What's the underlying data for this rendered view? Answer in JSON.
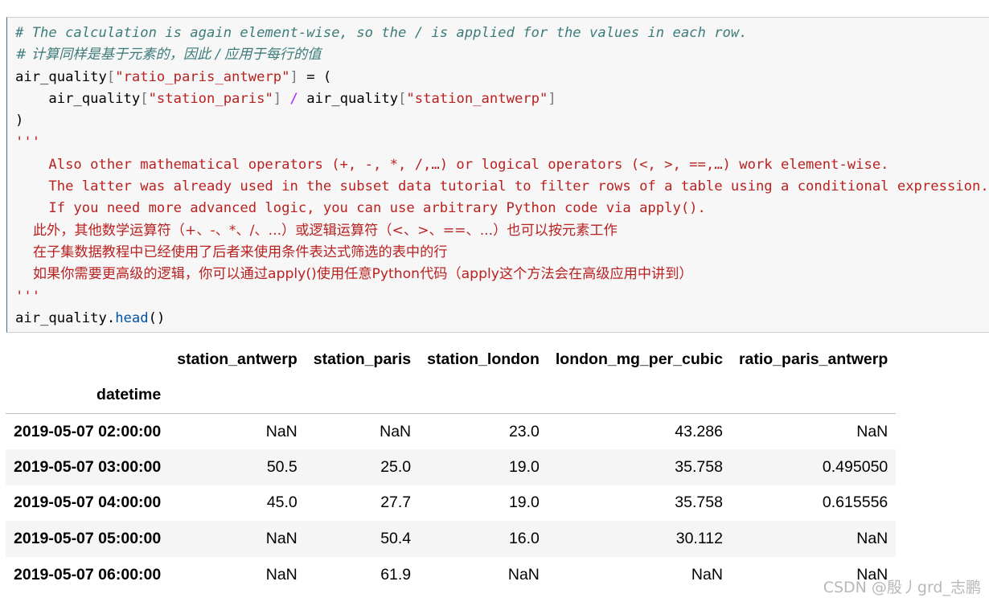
{
  "code_cell": {
    "comment_en": "# The calculation is again element-wise, so the / is applied for the values in each row.",
    "comment_zh": "# 计算同样是基于元素的，因此 / 应用于每行的值",
    "l3_var": "air_quality",
    "l3_key": "\"ratio_paris_antwerp\"",
    "l3_rest": " = (",
    "l4_var1": "    air_quality",
    "l4_key1": "\"station_paris\"",
    "l4_op": "/",
    "l4_var2": "air_quality",
    "l4_key2": "\"station_antwerp\"",
    "l5": ")",
    "docstring_quote": "'''",
    "doc_lines": [
      "    Also other mathematical operators (+, -, *, /,…) or logical operators (<, >, ==,…) work element-wise.",
      "    The latter was already used in the subset data tutorial to filter rows of a table using a conditional expression.",
      "    If you need more advanced logic, you can use arbitrary Python code via apply().",
      "    此外，其他数学运算符（+、-、*、/、...）或逻辑运算符（<、>、==、...）也可以按元素工作",
      "    在子集数据教程中已经使用了后者来使用条件表达式筛选的表中的行",
      "    如果你需要更高级的逻辑，你可以通过apply()使用任意Python代码（apply这个方法会在高级应用中讲到）"
    ],
    "last_var": "air_quality",
    "last_method": "head",
    "last_call": "()"
  },
  "dataframe": {
    "columns": [
      "station_antwerp",
      "station_paris",
      "station_london",
      "london_mg_per_cubic",
      "ratio_paris_antwerp"
    ],
    "index_name": "datetime",
    "rows": [
      {
        "index": "2019-05-07 02:00:00",
        "values": [
          "NaN",
          "NaN",
          "23.0",
          "43.286",
          "NaN"
        ]
      },
      {
        "index": "2019-05-07 03:00:00",
        "values": [
          "50.5",
          "25.0",
          "19.0",
          "35.758",
          "0.495050"
        ]
      },
      {
        "index": "2019-05-07 04:00:00",
        "values": [
          "45.0",
          "27.7",
          "19.0",
          "35.758",
          "0.615556"
        ]
      },
      {
        "index": "2019-05-07 05:00:00",
        "values": [
          "NaN",
          "50.4",
          "16.0",
          "30.112",
          "NaN"
        ]
      },
      {
        "index": "2019-05-07 06:00:00",
        "values": [
          "NaN",
          "61.9",
          "NaN",
          "NaN",
          "NaN"
        ]
      }
    ]
  },
  "watermark": "CSDN @殷丿grd_志鹏"
}
